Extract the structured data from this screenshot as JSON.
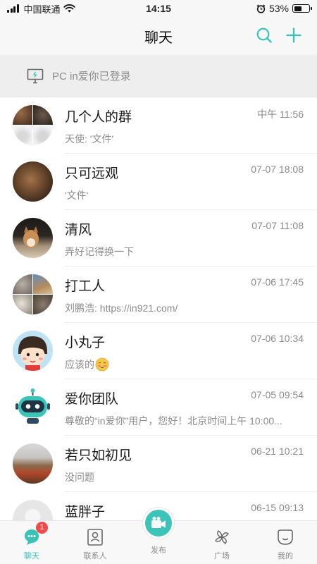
{
  "status_bar": {
    "carrier": "中国联通",
    "time": "14:15",
    "battery": "53%",
    "battery_level": 0.53
  },
  "header": {
    "title": "聊天",
    "search_icon": "search-icon",
    "add_icon": "plus-icon",
    "accent_color": "#39c3b8"
  },
  "pc_banner": {
    "text": "PC in爱你已登录",
    "icon": "monitor-icon"
  },
  "chats": [
    {
      "name": "几个人的群",
      "time": "中午 11:56",
      "preview": "天使: '文件'"
    },
    {
      "name": "只可远观",
      "time": "07-07 18:08",
      "preview": "'文件'"
    },
    {
      "name": "清风",
      "time": "07-07 11:08",
      "preview": "弄好记得换一下"
    },
    {
      "name": "打工人",
      "time": "07-06 17:45",
      "preview": "刘鹏浩: https://in921.com/"
    },
    {
      "name": "小丸子",
      "time": "07-06 10:34",
      "preview": "应该的"
    },
    {
      "name": "爱你团队",
      "time": "07-05 09:54",
      "preview": "尊敬的“in爱你”用户，您好！北京时间上午 10:00..."
    },
    {
      "name": "若只如初见",
      "time": "06-21 10:21",
      "preview": "没问题"
    },
    {
      "name": "蓝胖子",
      "time": "06-15 09:13",
      "preview": ""
    }
  ],
  "tab_bar": {
    "chat": {
      "label": "聊天",
      "badge": "1"
    },
    "contacts": {
      "label": "联系人"
    },
    "publish": {
      "label": "发布"
    },
    "plaza": {
      "label": "广场"
    },
    "mine": {
      "label": "我的"
    }
  }
}
